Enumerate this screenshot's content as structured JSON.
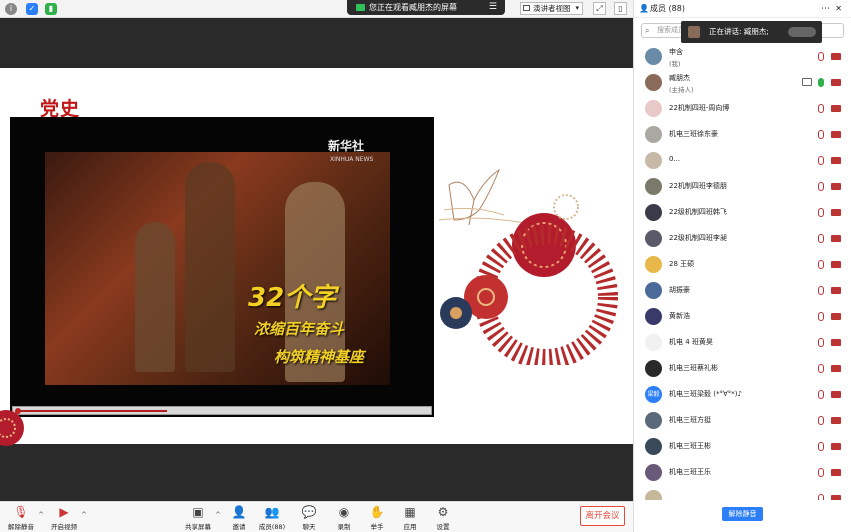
{
  "banner": {
    "text": "您正在观看臧朋杰的屏幕",
    "menu": "☰"
  },
  "view_select": {
    "label": "演讲者视图"
  },
  "slide": {
    "title": "党史"
  },
  "video": {
    "watermark_cn": "新华社",
    "watermark_en": "XINHUA NEWS",
    "caption_1": "32个字",
    "caption_2": "浓缩百年奋斗",
    "caption_3": "构筑精神基座",
    "progress": 0.37
  },
  "toolbar": {
    "unmute": "解除静音",
    "start_video": "开启视频",
    "share": "共享屏幕",
    "invite": "邀请",
    "members": "成员(88)",
    "chat": "聊天",
    "record": "录制",
    "raise_hand": "举手",
    "apps": "应用",
    "settings": "设置",
    "leave": "离开会议"
  },
  "panel": {
    "title": "成员 (88)",
    "search_placeholder": "搜索成员",
    "speaking": "正在讲话: 臧朋杰;",
    "unmute_all": "解除静音",
    "members": [
      {
        "name": "申含",
        "sub": "(我)",
        "color": "#6a8ba8"
      },
      {
        "name": "臧朋杰",
        "sub": "(主持人)",
        "color": "#8a6b5a",
        "mic_on": true,
        "sharing": true
      },
      {
        "name": "22机制四班-周向博",
        "color": "#e8c8c8"
      },
      {
        "name": "机电三班徐东豪",
        "color": "#aaa8a2"
      },
      {
        "name": "0...",
        "color": "#c8b8a8"
      },
      {
        "name": "22机制四班李德朋",
        "color": "#7a7a6a"
      },
      {
        "name": "22级机制四班韩飞",
        "color": "#3a3a48"
      },
      {
        "name": "22级机制四班李昶",
        "color": "#5a5a6a"
      },
      {
        "name": "28 王硕",
        "color": "#e8b84a"
      },
      {
        "name": "胡振豪",
        "color": "#4a6a9a"
      },
      {
        "name": "黄新浩",
        "color": "#3a3a6a"
      },
      {
        "name": "机电 4 班黄昊",
        "color": "#f0f0f0"
      },
      {
        "name": "机电三班蔡礼彬",
        "color": "#2a2a2a"
      },
      {
        "name": "机电三班梁毅 (*°∀°*)♪",
        "avatar_text": "梁毅",
        "color": "#2d7ff9"
      },
      {
        "name": "机电三班方挺",
        "color": "#5a6a7a"
      },
      {
        "name": "机电三班王彬",
        "color": "#3a4a5a"
      },
      {
        "name": "机电三班王乐",
        "color": "#6a5a7a"
      },
      {
        "name": "",
        "color": "#c8b89a"
      }
    ]
  }
}
